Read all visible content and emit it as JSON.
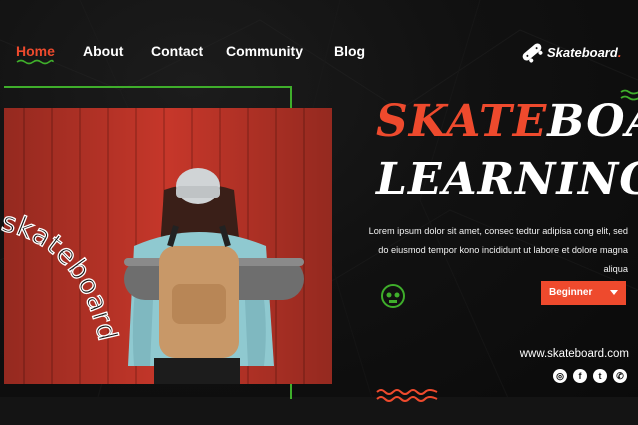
{
  "nav": {
    "items": [
      {
        "label": "Home",
        "active": true
      },
      {
        "label": "About",
        "active": false
      },
      {
        "label": "Contact",
        "active": false
      },
      {
        "label": "Community",
        "active": false
      },
      {
        "label": "Blog",
        "active": false
      }
    ]
  },
  "logo": {
    "text": "Skateboard",
    "icon": "skateboard-icon"
  },
  "headline": {
    "word_red": "SKATE",
    "word_white": "BOARD",
    "line2": "LEARNING"
  },
  "description": "Lorem ipsum dolor sit amet, consec tedtur adipisa cong elit, sed do eiusmod tempor kono incididunt ut labore et dolore magna aliqua",
  "level_select": {
    "selected": "Beginner",
    "icon": "caret-down-icon"
  },
  "website": "www.skateboard.com",
  "curved_text": "skateboard",
  "socials": [
    {
      "name": "instagram-icon",
      "glyph": "◎"
    },
    {
      "name": "facebook-icon",
      "glyph": "f"
    },
    {
      "name": "twitter-icon",
      "glyph": "t"
    },
    {
      "name": "whatsapp-icon",
      "glyph": "✆"
    }
  ],
  "colors": {
    "accent": "#ee4a2d",
    "green": "#3fae2b",
    "background": "#0d0d0d",
    "photo_red": "#c6372a"
  }
}
